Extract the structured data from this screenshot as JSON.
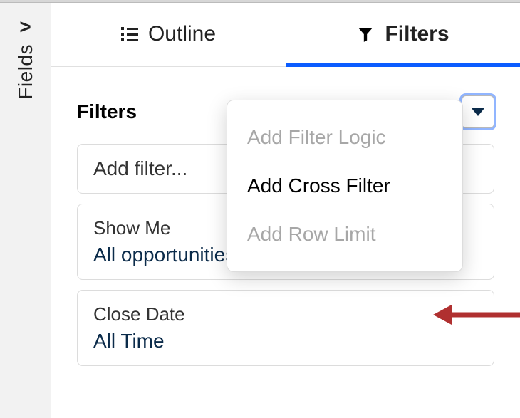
{
  "left_rail": {
    "expand_glyph": ">",
    "label": "Fields"
  },
  "tabs": {
    "outline_label": "Outline",
    "filters_label": "Filters"
  },
  "panel": {
    "title": "Filters"
  },
  "filters": {
    "add_placeholder": "Add filter...",
    "show_me": {
      "label": "Show Me",
      "value": "All opportunities"
    },
    "close_date": {
      "label": "Close Date",
      "value": "All Time"
    }
  },
  "menu": {
    "add_filter_logic": "Add Filter Logic",
    "add_cross_filter": "Add Cross Filter",
    "add_row_limit": "Add Row Limit"
  },
  "annotation": {
    "color": "#b03030"
  }
}
